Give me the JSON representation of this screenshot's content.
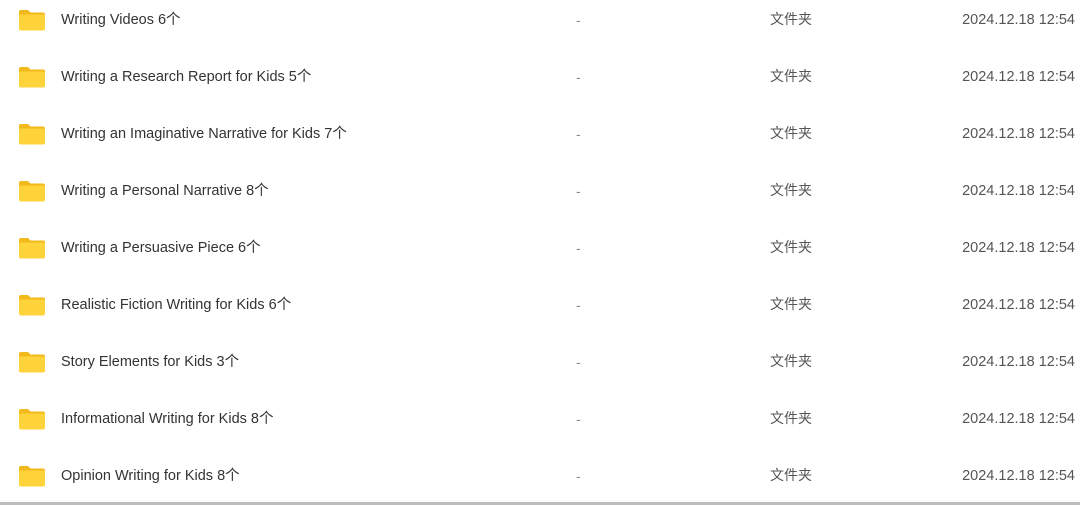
{
  "files": [
    {
      "name": "Writing Videos 6个",
      "size": "-",
      "type": "文件夹",
      "date": "2024.12.18 12:54",
      "icon": "folder-icon"
    },
    {
      "name": "Writing a Research Report for Kids 5个",
      "size": "-",
      "type": "文件夹",
      "date": "2024.12.18 12:54",
      "icon": "folder-icon"
    },
    {
      "name": "Writing an Imaginative Narrative for Kids 7个",
      "size": "-",
      "type": "文件夹",
      "date": "2024.12.18 12:54",
      "icon": "folder-icon"
    },
    {
      "name": "Writing a Personal Narrative 8个",
      "size": "-",
      "type": "文件夹",
      "date": "2024.12.18 12:54",
      "icon": "folder-icon"
    },
    {
      "name": "Writing a Persuasive Piece 6个",
      "size": "-",
      "type": "文件夹",
      "date": "2024.12.18 12:54",
      "icon": "folder-icon"
    },
    {
      "name": "Realistic Fiction Writing for Kids 6个",
      "size": "-",
      "type": "文件夹",
      "date": "2024.12.18 12:54",
      "icon": "folder-icon"
    },
    {
      "name": "Story Elements for Kids 3个",
      "size": "-",
      "type": "文件夹",
      "date": "2024.12.18 12:54",
      "icon": "folder-icon"
    },
    {
      "name": "Informational Writing for Kids 8个",
      "size": "-",
      "type": "文件夹",
      "date": "2024.12.18 12:54",
      "icon": "folder-icon"
    },
    {
      "name": "Opinion Writing for Kids 8个",
      "size": "-",
      "type": "文件夹",
      "date": "2024.12.18 12:54",
      "icon": "folder-icon"
    }
  ],
  "colors": {
    "folder_back": "#f2b91a",
    "folder_front": "#ffd43b",
    "text": "#333333",
    "muted": "#8a8a8a"
  }
}
